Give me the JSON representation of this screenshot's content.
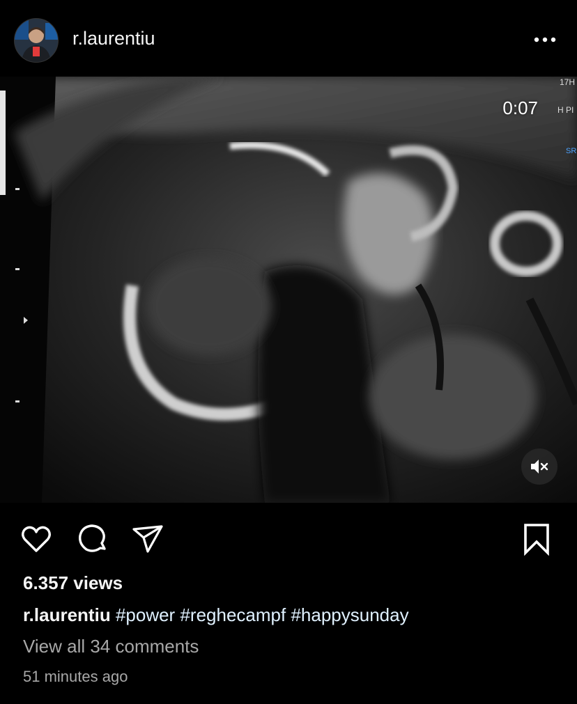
{
  "post": {
    "username": "r.laurentiu",
    "avatar_icon": "profile-photo",
    "more_icon": "more-horizontal-icon"
  },
  "video": {
    "timer": "0:07",
    "mute_icon": "speaker-muted-icon",
    "overlay_labels": [
      "17H",
      "H PI",
      "SR"
    ]
  },
  "actions": {
    "like_icon": "heart-icon",
    "comment_icon": "comment-bubble-icon",
    "share_icon": "send-arrow-icon",
    "save_icon": "bookmark-icon"
  },
  "stats": {
    "views": "6.357 views"
  },
  "caption": {
    "username": "r.laurentiu",
    "hashtags": [
      "#power",
      "#reghecampf",
      "#happysunday"
    ]
  },
  "comments": {
    "view_all": "View all 34 comments"
  },
  "time_ago": "51 minutes ago",
  "colors": {
    "background": "#000000",
    "text_primary": "#f5f5f5",
    "text_secondary": "#a8a8a8",
    "hashtag": "#e0f1ff"
  }
}
